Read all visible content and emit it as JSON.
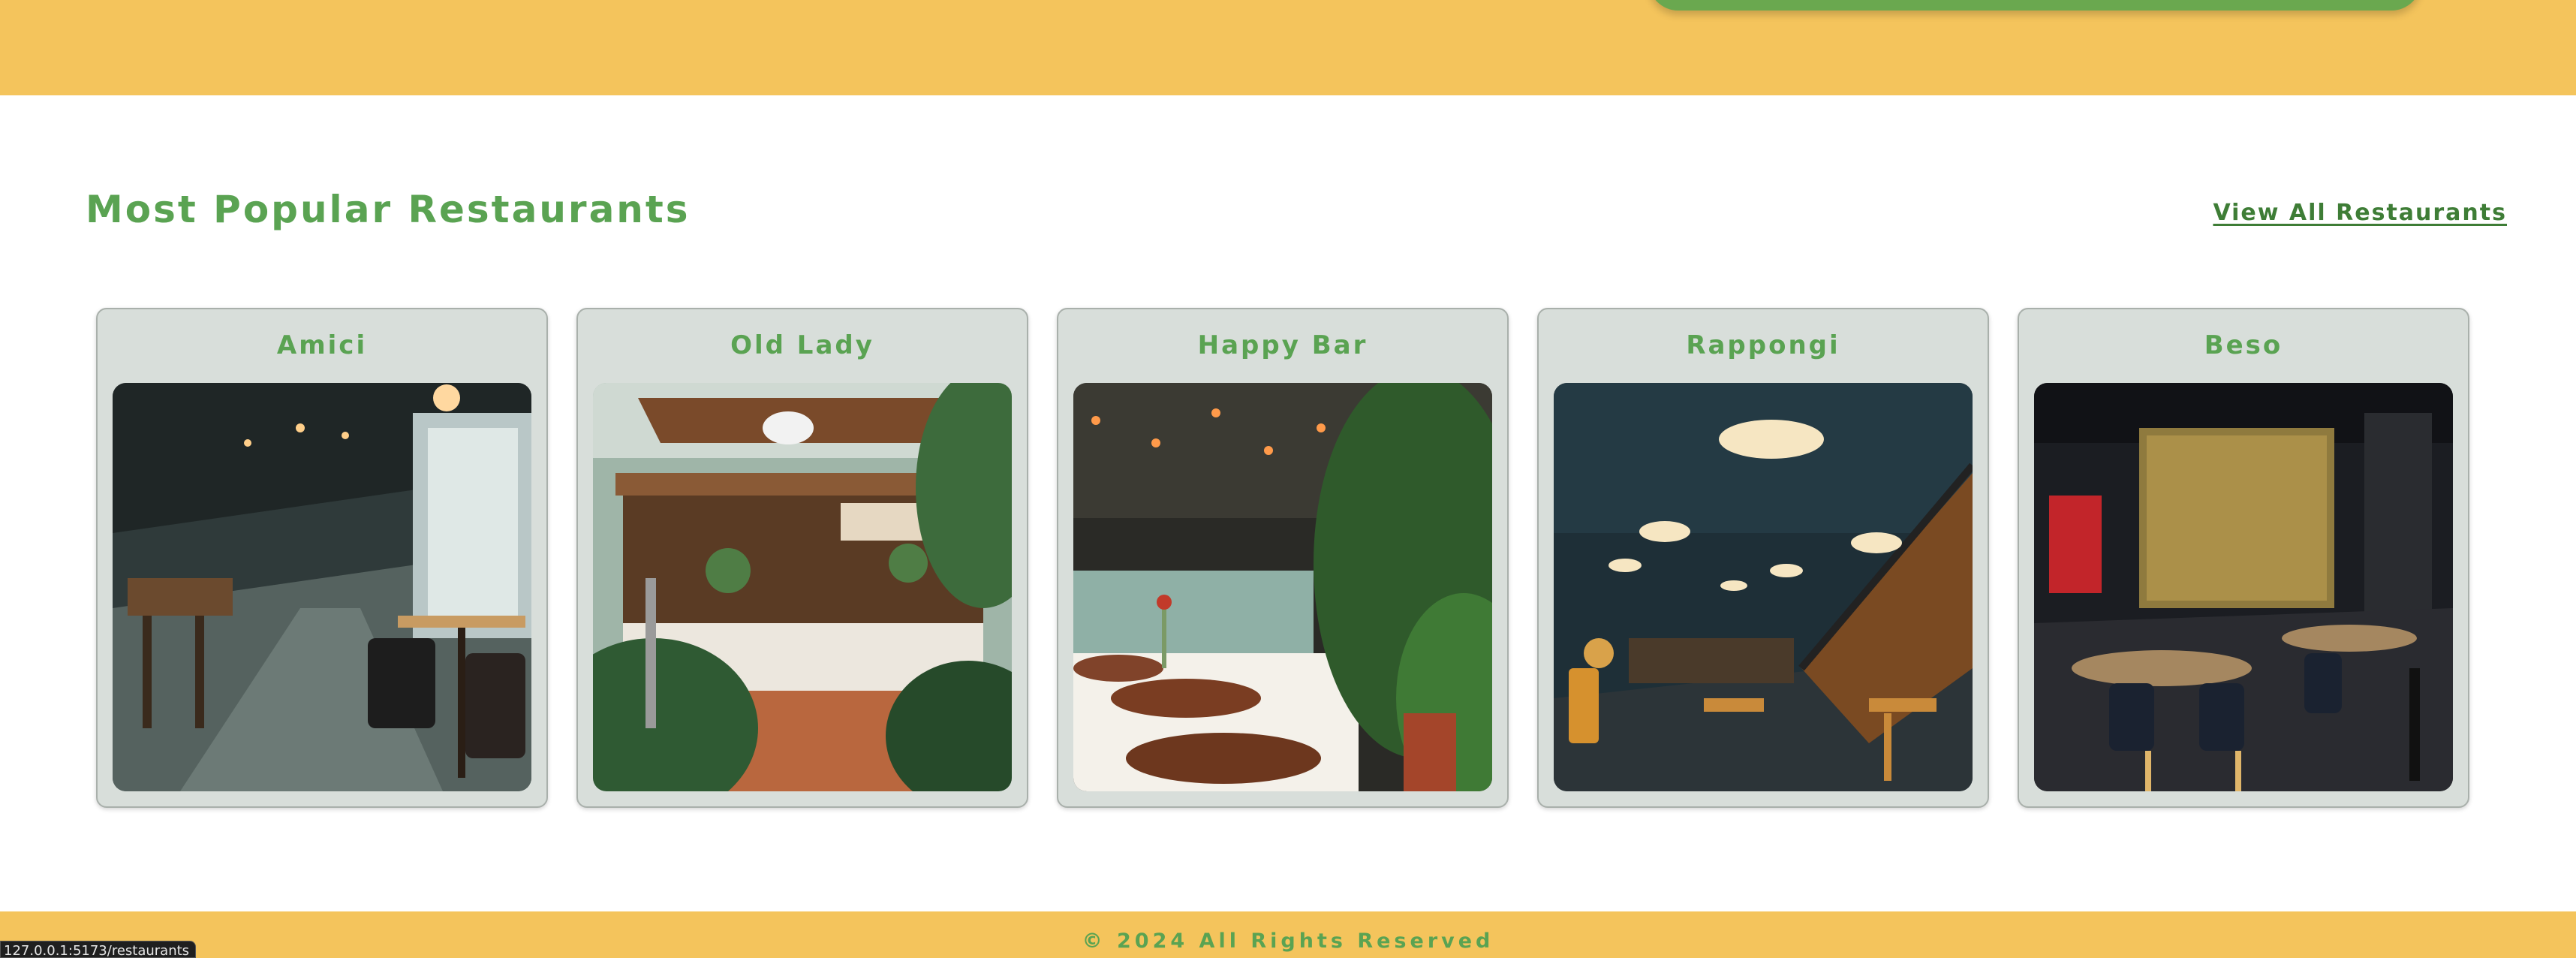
{
  "section": {
    "title": "Most Popular Restaurants",
    "view_all_label": "View All Restaurants"
  },
  "restaurants": [
    {
      "name": "Amici",
      "photo": "restaurant-interior-photo"
    },
    {
      "name": "Old Lady",
      "photo": "restaurant-interior-photo"
    },
    {
      "name": "Happy Bar",
      "photo": "restaurant-interior-photo"
    },
    {
      "name": "Rappongi",
      "photo": "restaurant-interior-photo"
    },
    {
      "name": "Beso",
      "photo": "restaurant-interior-photo"
    }
  ],
  "footer": {
    "copyright": "© 2024 All Rights Reserved"
  },
  "status_bar": {
    "url": "127.0.0.1:5173/restaurants"
  },
  "colors": {
    "brand_yellow": "#f4c45c",
    "brand_green": "#5aa352",
    "link_green": "#3e7d36",
    "card_background": "#d8deda"
  }
}
